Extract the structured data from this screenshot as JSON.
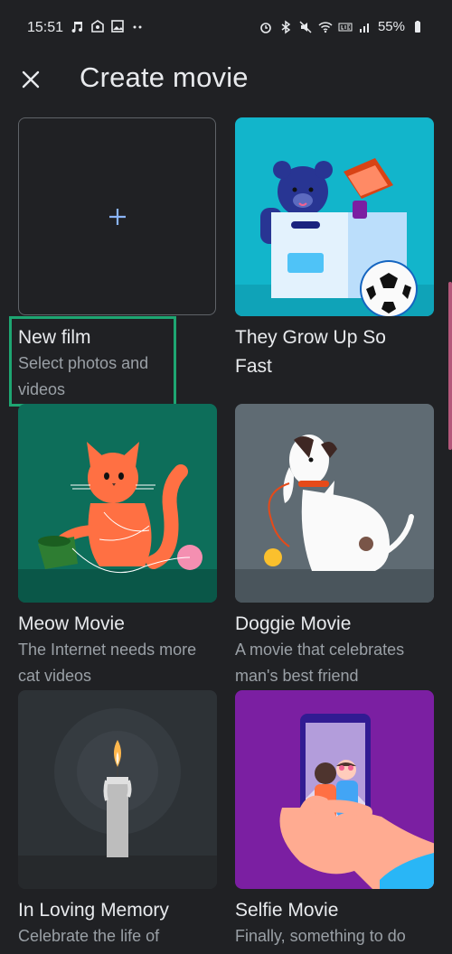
{
  "status_bar": {
    "time": "15:51",
    "battery": "55%",
    "left_icons": [
      "music-icon",
      "mail-icon",
      "image-icon",
      "more-dots-icon"
    ],
    "right_icons": [
      "alarm-icon",
      "bluetooth-icon",
      "mute-icon",
      "wifi-icon",
      "lte-icon",
      "signal-icon",
      "battery-icon"
    ]
  },
  "app_bar": {
    "title": "Create movie",
    "close_icon": "close-icon"
  },
  "cards": [
    {
      "title": "New film",
      "subtitle_line1": "Select photos and",
      "subtitle_line2": "videos",
      "icon": "plus-icon"
    },
    {
      "title_line1": "They Grow Up So",
      "title_line2": "Fast"
    },
    {
      "title": "Meow Movie",
      "subtitle_line1": "The Internet needs more",
      "subtitle_line2": "cat videos"
    },
    {
      "title": "Doggie Movie",
      "subtitle_line1": "A movie that celebrates",
      "subtitle_line2": "man's best friend"
    },
    {
      "title": "In Loving Memory",
      "subtitle_line1": "Celebrate the life of"
    },
    {
      "title": "Selfie Movie",
      "subtitle_line1": "Finally, something to do"
    }
  ],
  "colors": {
    "background": "#202124",
    "highlight": "#1ea672",
    "plus": "#8ab4f8",
    "teal_card": "#12b5cb",
    "green_card": "#0d6e5a",
    "grey_card": "#5f6b73",
    "dark_card": "#2d3236",
    "purple_card": "#7b1fa2"
  }
}
